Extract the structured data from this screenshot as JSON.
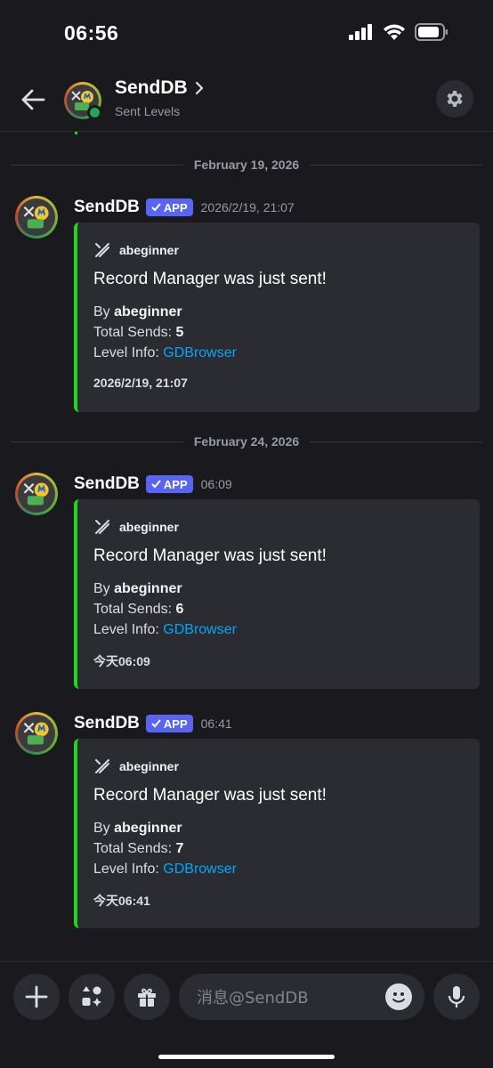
{
  "status_bar": {
    "time": "06:56"
  },
  "header": {
    "title": "SendDB",
    "subtitle": "Sent Levels"
  },
  "date_separators": [
    "February 19, 2026",
    "February 24, 2026"
  ],
  "messages": [
    {
      "author": "SendDB",
      "badge": "APP",
      "time": "2026/2/19, 21:07",
      "embed": {
        "author": "abeginner",
        "title": "Record Manager was just sent!",
        "by_label": "By",
        "by_value": "abeginner",
        "sends_label": "Total Sends:",
        "sends_value": "5",
        "info_label": "Level Info:",
        "info_link": "GDBrowser",
        "footer": "2026/2/19, 21:07"
      }
    },
    {
      "author": "SendDB",
      "badge": "APP",
      "time": "06:09",
      "embed": {
        "author": "abeginner",
        "title": "Record Manager was just sent!",
        "by_label": "By",
        "by_value": "abeginner",
        "sends_label": "Total Sends:",
        "sends_value": "6",
        "info_label": "Level Info:",
        "info_link": "GDBrowser",
        "footer": "今天06:09"
      }
    },
    {
      "author": "SendDB",
      "badge": "APP",
      "time": "06:41",
      "embed": {
        "author": "abeginner",
        "title": "Record Manager was just sent!",
        "by_label": "By",
        "by_value": "abeginner",
        "sends_label": "Total Sends:",
        "sends_value": "7",
        "info_label": "Level Info:",
        "info_link": "GDBrowser",
        "footer": "今天06:41"
      }
    }
  ],
  "composer": {
    "placeholder": "消息@SendDB"
  },
  "colors": {
    "embed_accent": "#1cd91c",
    "app_badge": "#5865f2",
    "link": "#00a8fc",
    "online": "#23a55a"
  },
  "icons": [
    "cellular-signal-icon",
    "wifi-icon",
    "battery-icon",
    "back-arrow-icon",
    "chevron-right-icon",
    "gear-icon",
    "hammer-pick-icon",
    "checkmark-icon",
    "plus-icon",
    "apps-icon",
    "gift-icon",
    "emoji-icon",
    "microphone-icon"
  ]
}
